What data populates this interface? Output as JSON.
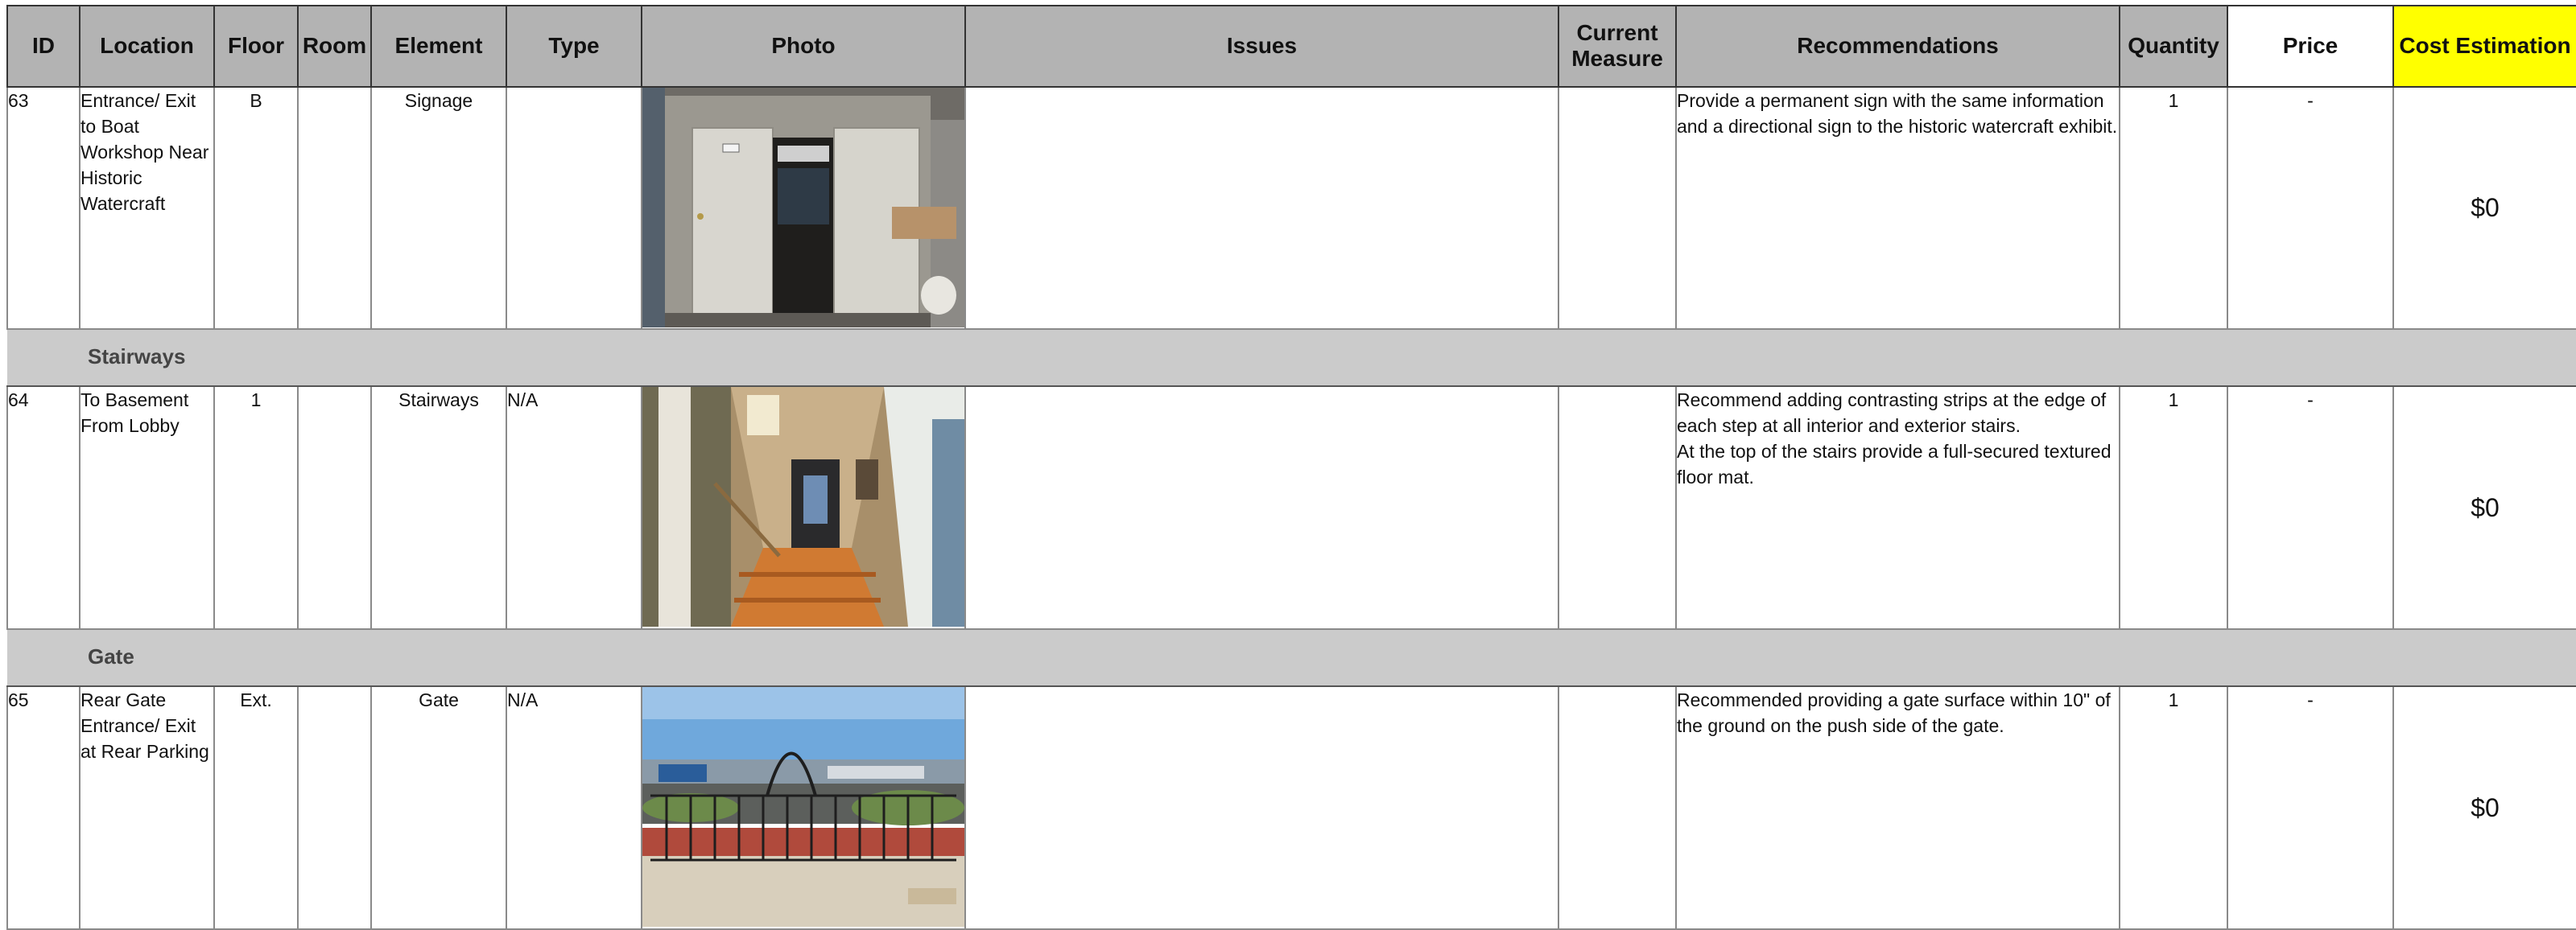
{
  "headers": {
    "id": "ID",
    "location": "Location",
    "floor": "Floor",
    "room": "Room",
    "element": "Element",
    "type": "Type",
    "photo": "Photo",
    "issues": "Issues",
    "current_measure": "Current Measure",
    "recommendations": "Recommendations",
    "quantity": "Quantity",
    "price": "Price",
    "cost_estimation": "Cost Estimation"
  },
  "sections": {
    "stairways": "Stairways",
    "gate": "Gate"
  },
  "rows": [
    {
      "id": "63",
      "location": "Entrance/ Exit to Boat Workshop Near Historic Watercraft",
      "floor": "B",
      "room": "",
      "element": "Signage",
      "type": "",
      "photo_icon": "workshop-door-photo",
      "issues": "",
      "current_measure": "",
      "recommendations": "Provide a permanent sign with the same information and a directional sign to the historic watercraft exhibit.",
      "quantity": "1",
      "price": "-",
      "cost": "$0"
    },
    {
      "id": "64",
      "location": "To Basement From Lobby",
      "floor": "1",
      "room": "",
      "element": "Stairways",
      "type": "N/A",
      "photo_icon": "stairway-photo",
      "issues": "",
      "current_measure": "",
      "recommendations": "Recommend adding contrasting strips at the edge of each step at all interior and exterior stairs.\nAt the top of the stairs provide a full-secured textured floor mat.",
      "quantity": "1",
      "price": "-",
      "cost": "$0"
    },
    {
      "id": "65",
      "location": "Rear Gate Entrance/ Exit at Rear Parking",
      "floor": "Ext.",
      "room": "",
      "element": "Gate",
      "type": "N/A",
      "photo_icon": "gate-photo",
      "issues": "",
      "current_measure": "",
      "recommendations": "Recommended providing a gate surface within 10\" of the ground on the push side of the gate.",
      "quantity": "1",
      "price": "-",
      "cost": "$0"
    }
  ],
  "colors": {
    "header_bg": "#b3b3b3",
    "section_bg": "#cbcbcb",
    "cost_header_bg": "#ffff00"
  }
}
